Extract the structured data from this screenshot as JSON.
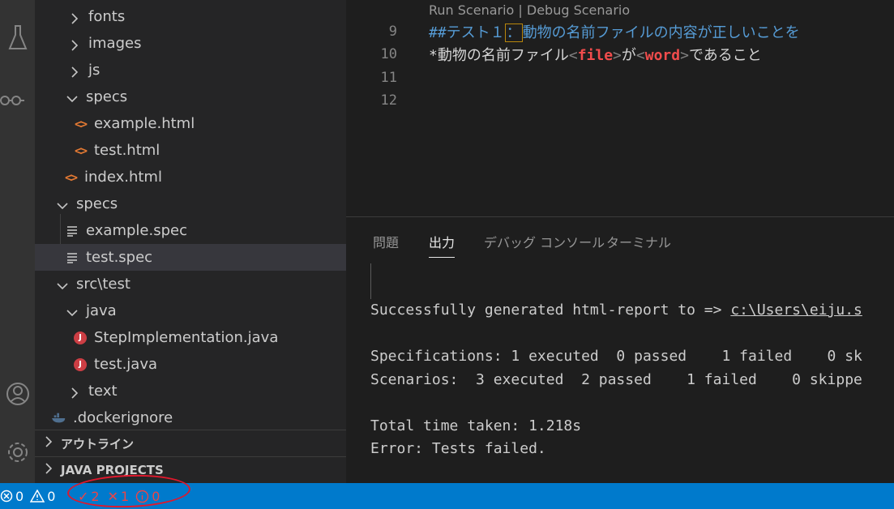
{
  "explorer": {
    "rows": [
      {
        "label": "fonts"
      },
      {
        "label": "images"
      },
      {
        "label": "js"
      },
      {
        "label": "specs"
      },
      {
        "label": "example.html"
      },
      {
        "label": "test.html"
      },
      {
        "label": "index.html"
      },
      {
        "label": "specs"
      },
      {
        "label": "example.spec"
      },
      {
        "label": "test.spec"
      },
      {
        "label": "src\\test"
      },
      {
        "label": "java"
      },
      {
        "label": "StepImplementation.java"
      },
      {
        "label": "test.java"
      },
      {
        "label": "text"
      },
      {
        "label": ".dockerignore"
      }
    ],
    "sections": {
      "outline": "アウトライン",
      "java_projects": "JAVA PROJECTS"
    }
  },
  "editor": {
    "codelens": "Run Scenario | Debug Scenario",
    "lines": [
      {
        "num": "9",
        "heading": "##テスト１",
        "colon": "：",
        "rest": "動物の名前ファイルの内容が正しいことを"
      },
      {
        "num": "10",
        "star": "*",
        "t1": "動物の名前ファイル",
        "p1_open": "<",
        "p1": "file",
        "p1_close": ">",
        "t2": "が",
        "p2_open": "<",
        "p2": "word",
        "p2_close": ">",
        "t3": "であること"
      },
      {
        "num": "11"
      },
      {
        "num": "12"
      }
    ]
  },
  "panel": {
    "tabs": [
      {
        "label": "問題"
      },
      {
        "label": "出力"
      },
      {
        "label": "デバッグ コンソール"
      },
      {
        "label": "ターミナル"
      }
    ],
    "output": {
      "report_prefix": "Successfully generated html-report to => ",
      "report_path": "c:\\Users\\eiju.s",
      "specs": "Specifications: 1 executed  0 passed    1 failed    0 sk",
      "scenarios": "Scenarios:  3 executed  2 passed    1 failed    0 skippe",
      "time": "Total time taken: 1.218s",
      "error": "Error: Tests failed."
    }
  },
  "statusbar": {
    "errors": "0",
    "warnings": "0",
    "passed": "2",
    "failed": "1",
    "info": "0"
  }
}
